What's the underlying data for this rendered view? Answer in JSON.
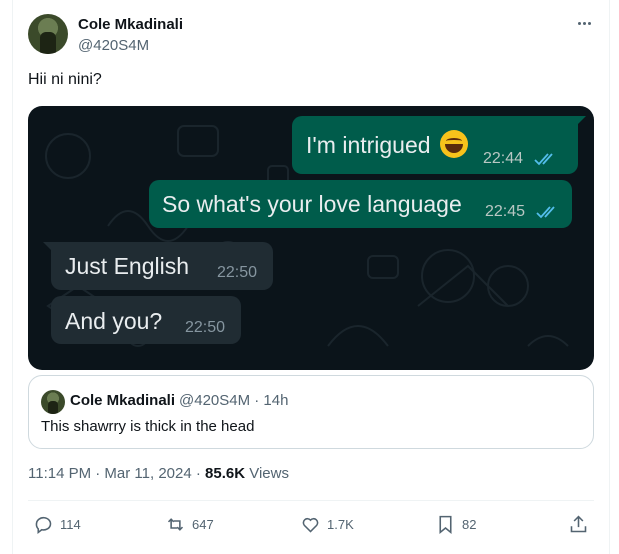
{
  "author": {
    "display_name": "Cole Mkadinali",
    "handle": "@420S4M"
  },
  "tweet": {
    "text": "Hii ni nini?"
  },
  "chat_image": {
    "messages": [
      {
        "direction": "out",
        "text": "I'm intrigued",
        "emoji": "rolling-on-floor-laughing",
        "time": "22:44",
        "status": "read"
      },
      {
        "direction": "out",
        "text": "So what's your love language",
        "time": "22:45",
        "status": "read"
      },
      {
        "direction": "in",
        "text": "Just English",
        "time": "22:50"
      },
      {
        "direction": "in",
        "text": "And you?",
        "time": "22:50"
      }
    ],
    "colors": {
      "background": "#0b141a",
      "outgoing": "#005c4b",
      "incoming": "#202c33",
      "read_ticks": "#53bdeb"
    }
  },
  "quoted_tweet": {
    "display_name": "Cole Mkadinali",
    "handle_time": "@420S4M · 14h",
    "text": "This shawrry is thick in the head"
  },
  "meta": {
    "time_date": "11:14 PM · Mar 11, 2024 · ",
    "views_count": "85.6K",
    "views_label": " Views"
  },
  "actions": {
    "replies": "114",
    "reposts": "647",
    "likes": "1.7K",
    "bookmarks": "82"
  }
}
